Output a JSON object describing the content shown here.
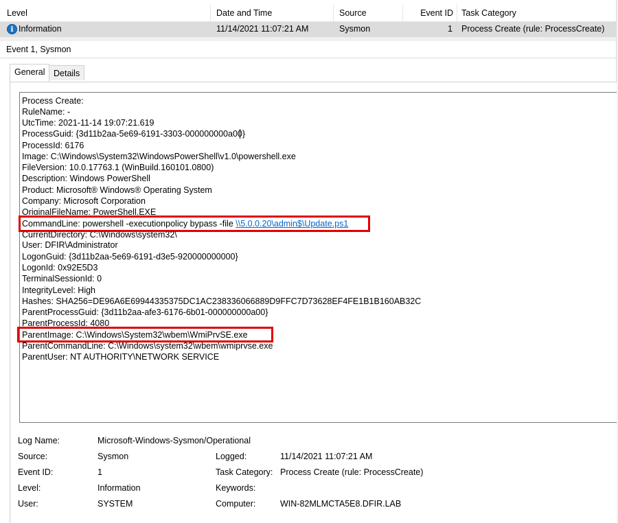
{
  "grid": {
    "headers": {
      "level": "Level",
      "datetime": "Date and Time",
      "source": "Source",
      "event_id": "Event ID",
      "task_category": "Task Category"
    },
    "row": {
      "level": "Information",
      "datetime": "11/14/2021 11:07:21 AM",
      "source": "Sysmon",
      "event_id": "1",
      "task_category": "Process Create (rule: ProcessCreate)"
    }
  },
  "pane_title": "Event 1, Sysmon",
  "tabs": {
    "general": "General",
    "details": "Details"
  },
  "event_text": {
    "lines": [
      "Process Create:",
      "RuleName: -",
      "UtcTime: 2021-11-14 19:07:21.619",
      "ProcessGuid: {3d11b2aa-5e69-6191-3303-000000000a00}",
      "ProcessId: 6176",
      "Image: C:\\Windows\\System32\\WindowsPowerShell\\v1.0\\powershell.exe",
      "FileVersion: 10.0.17763.1 (WinBuild.160101.0800)",
      "Description: Windows PowerShell",
      "Product: Microsoft® Windows® Operating System",
      "Company: Microsoft Corporation",
      "OriginalFileName: PowerShell.EXE",
      "",
      "CurrentDirectory: C:\\Windows\\system32\\",
      "User: DFIR\\Administrator",
      "LogonGuid: {3d11b2aa-5e69-6191-d3e5-920000000000}",
      "LogonId: 0x92E5D3",
      "TerminalSessionId: 0",
      "IntegrityLevel: High",
      "Hashes: SHA256=DE96A6E69944335375DC1AC238336066889D9FFC7D73628EF4FE1B1B160AB32C",
      "ParentProcessGuid: {3d11b2aa-afe3-6176-6b01-000000000a00}",
      "ParentProcessId: 4080",
      "ParentImage: C:\\Windows\\System32\\wbem\\WmiPrvSE.exe",
      "ParentCommandLine: C:\\Windows\\system32\\wbem\\wmiprvse.exe",
      "ParentUser: NT AUTHORITY\\NETWORK SERVICE"
    ],
    "commandline_prefix": "CommandLine: powershell -executionpolicy bypass -file ",
    "commandline_link": "\\\\5.0.0.20\\admin$\\Update.ps1"
  },
  "meta": {
    "log_name_label": "Log Name:",
    "log_name": "Microsoft-Windows-Sysmon/Operational",
    "source_label": "Source:",
    "source": "Sysmon",
    "logged_label": "Logged:",
    "logged": "11/14/2021 11:07:21 AM",
    "event_id_label": "Event ID:",
    "event_id": "1",
    "task_category_label": "Task Category:",
    "task_category": "Process Create (rule: ProcessCreate)",
    "level_label": "Level:",
    "level": "Information",
    "keywords_label": "Keywords:",
    "keywords": "",
    "user_label": "User:",
    "user": "SYSTEM",
    "computer_label": "Computer:",
    "computer": "WIN-82MLMCTA5E8.DFIR.LAB"
  },
  "highlight_color": "#e00000",
  "link_color": "#0066cc",
  "icons": {
    "level": "info-icon"
  }
}
